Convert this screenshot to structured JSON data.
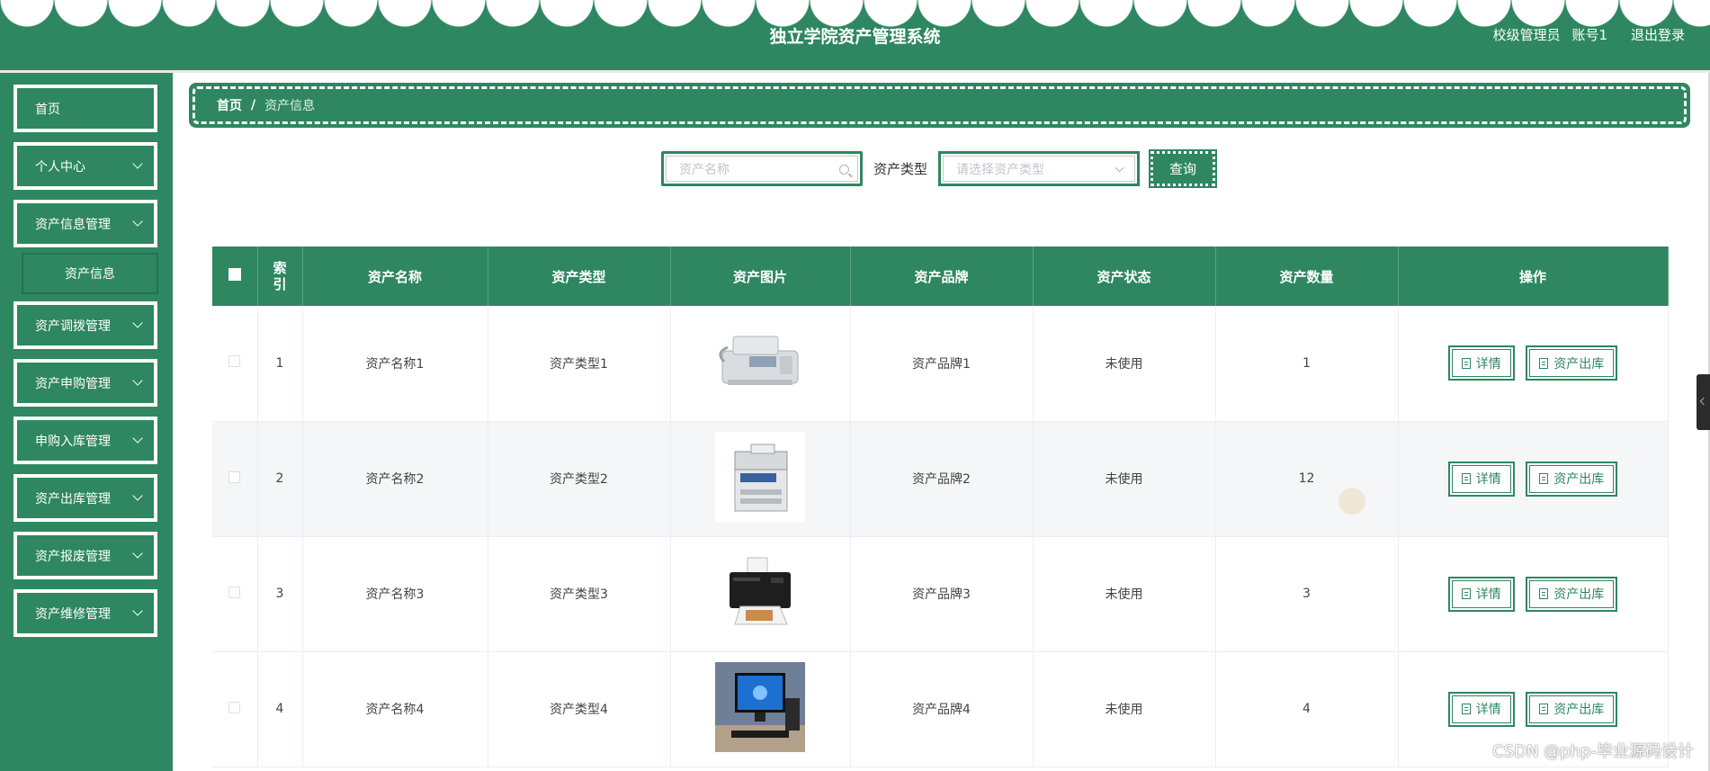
{
  "header": {
    "title": "独立学院资产管理系统",
    "user_role": "校级管理员",
    "account": "账号1",
    "logout": "退出登录",
    "brand_color": "#2e8760"
  },
  "sidebar": {
    "items": [
      {
        "label": "首页",
        "has_children": false
      },
      {
        "label": "个人中心",
        "has_children": true
      },
      {
        "label": "资产信息管理",
        "has_children": true,
        "expanded": true,
        "children": [
          "资产信息"
        ]
      },
      {
        "label": "资产调拨管理",
        "has_children": true
      },
      {
        "label": "资产申购管理",
        "has_children": true
      },
      {
        "label": "申购入库管理",
        "has_children": true
      },
      {
        "label": "资产出库管理",
        "has_children": true
      },
      {
        "label": "资产报废管理",
        "has_children": true
      },
      {
        "label": "资产维修管理",
        "has_children": true
      }
    ]
  },
  "breadcrumb": {
    "home": "首页",
    "separator": "/",
    "current": "资产信息"
  },
  "search": {
    "name_placeholder": "资产名称",
    "type_label": "资产类型",
    "type_placeholder": "请选择资产类型",
    "query_button": "查询"
  },
  "table": {
    "columns": [
      "",
      "索引",
      "资产名称",
      "资产类型",
      "资产图片",
      "资产品牌",
      "资产状态",
      "资产数量",
      "操作"
    ],
    "index_header": [
      "索",
      "引"
    ],
    "rows": [
      {
        "index": "1",
        "name": "资产名称1",
        "type": "资产类型1",
        "image": "fax-machine",
        "brand": "资产品牌1",
        "status": "未使用",
        "qty": "1"
      },
      {
        "index": "2",
        "name": "资产名称2",
        "type": "资产类型2",
        "image": "multifunction-printer",
        "brand": "资产品牌2",
        "status": "未使用",
        "qty": "12"
      },
      {
        "index": "3",
        "name": "资产名称3",
        "type": "资产类型3",
        "image": "inkjet-printer",
        "brand": "资产品牌3",
        "status": "未使用",
        "qty": "3"
      },
      {
        "index": "4",
        "name": "资产名称4",
        "type": "资产类型4",
        "image": "desktop-computer",
        "brand": "资产品牌4",
        "status": "未使用",
        "qty": "4"
      }
    ],
    "actions": {
      "detail": "详情",
      "outbound": "资产出库"
    }
  },
  "watermark": "CSDN @php-毕业源码设计"
}
